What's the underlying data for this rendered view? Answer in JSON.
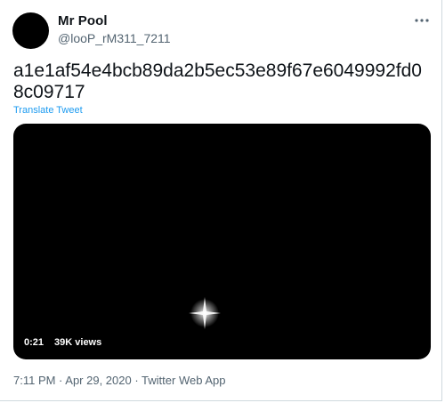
{
  "user": {
    "display_name": "Mr Pool",
    "handle": "@looP_rM311_7211"
  },
  "tweet": {
    "text": "a1e1af54e4bcb89da2b5ec53e89f67e6049992fd08c09717",
    "translate_label": "Translate Tweet"
  },
  "video": {
    "duration": "0:21",
    "views": "39K views"
  },
  "meta": {
    "timestamp": "7:11 PM · Apr 29, 2020 · Twitter Web App"
  },
  "icons": {
    "more": "more-horizontal-icon"
  },
  "colors": {
    "link": "#1d9bf0",
    "secondary_text": "#536471",
    "primary_text": "#0f1419"
  }
}
